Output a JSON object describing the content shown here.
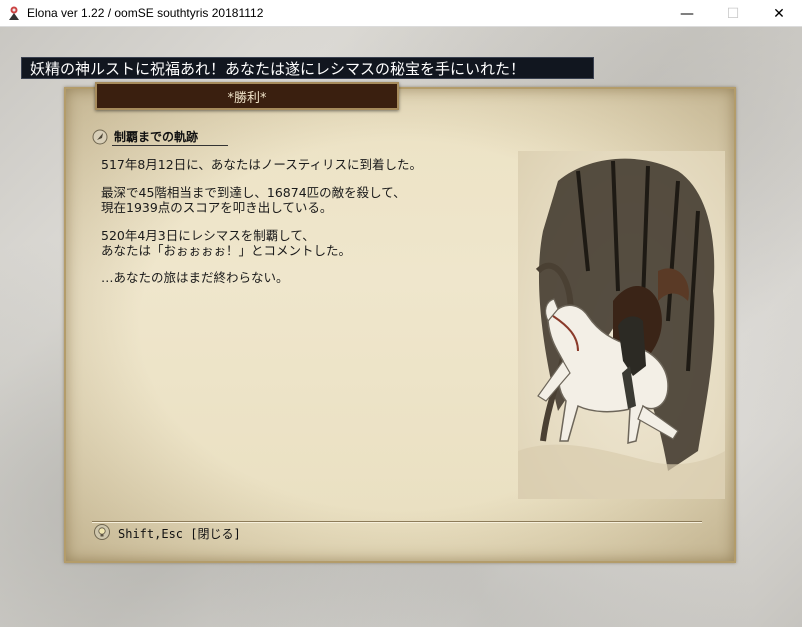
{
  "window": {
    "title": "Elona ver 1.22 / oomSE southtyris 20181112",
    "controls": {
      "minimize": "—",
      "maximize": "☐",
      "close": "✕"
    }
  },
  "banner": {
    "message": "妖精の神ルストに祝福あれ！あなたは遂にレシマスの秘宝を手にいれた！"
  },
  "dialog": {
    "tab_title": "*勝利*",
    "section_heading": "制覇までの軌跡",
    "paragraphs": [
      "517年8月12日に、あなたはノースティリスに到着した。",
      "最深で45階相当まで到達し、16874匹の敵を殺して、",
      "現在1939点のスコアを叩き出している。",
      "520年4月3日にレシマスを制覇して、",
      "あなたは「おぉぉぉぉ！」とコメントした。",
      "…あなたの旅はまだ終わらない。"
    ],
    "hint": "Shift,Esc [閉じる]"
  },
  "icons": {
    "app": "elona-app-icon",
    "section": "quill-bullet-icon",
    "hint": "lightbulb-icon"
  },
  "colors": {
    "banner_bg": "#11161f",
    "tab_bg": "#3a1f0f",
    "parchment": "#ece2c4"
  }
}
